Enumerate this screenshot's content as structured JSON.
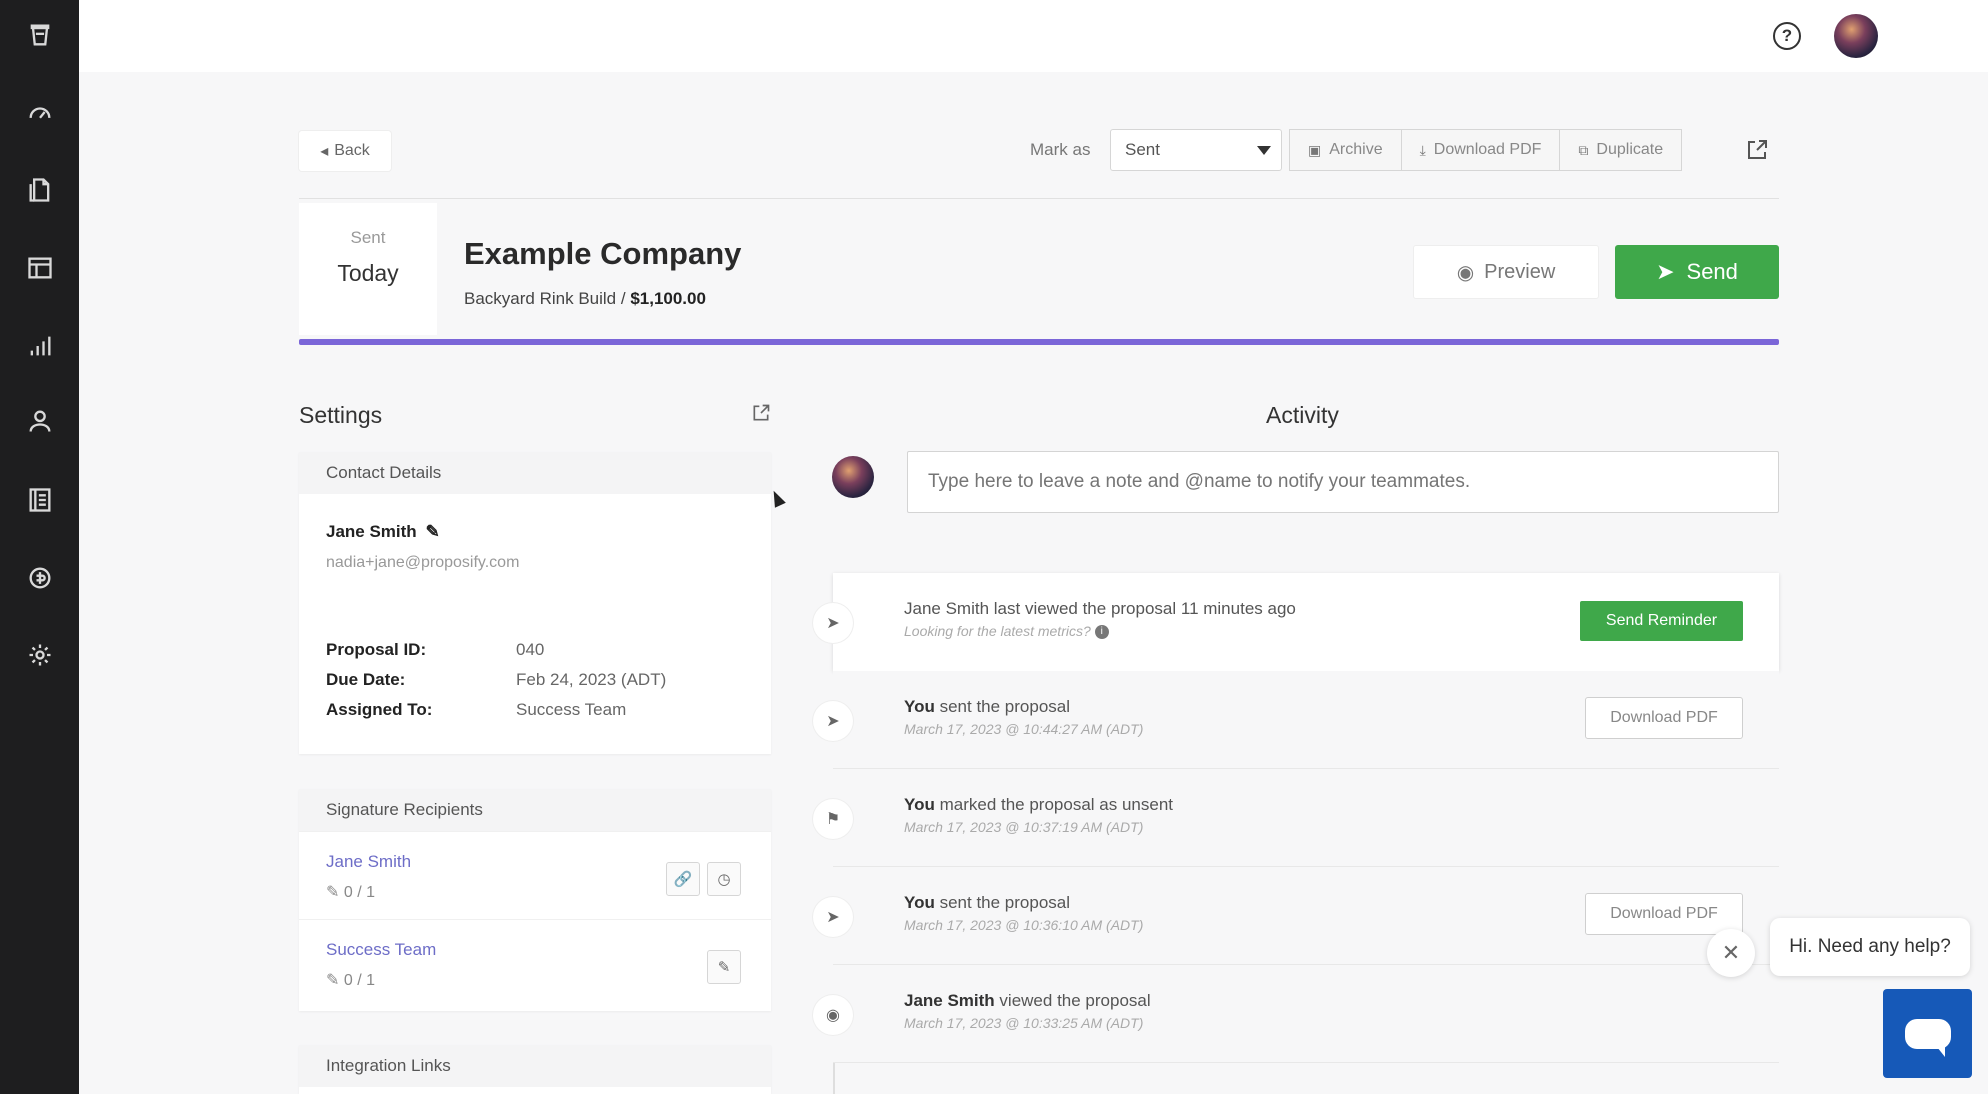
{
  "sidebar": {
    "icons": [
      "logo-cup-icon",
      "dashboard-gauge-icon",
      "documents-icon",
      "table-icon",
      "analytics-icon",
      "contacts-icon",
      "library-icon",
      "billing-icon",
      "settings-gear-icon"
    ]
  },
  "topbar": {
    "help_icon": "question-circle-icon"
  },
  "toolbar": {
    "back_label": "Back",
    "mark_as_label": "Mark as",
    "mark_as_value": "Sent",
    "archive_label": "Archive",
    "download_pdf_label": "Download PDF",
    "duplicate_label": "Duplicate"
  },
  "proposal": {
    "status_label": "Sent",
    "status_value": "Today",
    "company": "Example Company",
    "project": "Backyard Rink Build /",
    "amount": "$1,100.00",
    "preview_label": "Preview",
    "send_label": "Send"
  },
  "settings": {
    "title": "Settings",
    "contact": {
      "heading": "Contact Details",
      "name": "Jane Smith",
      "email": "nadia+jane@proposify.com",
      "fields": [
        {
          "key": "Proposal ID:",
          "value": "040"
        },
        {
          "key": "Due Date:",
          "value": "Feb 24, 2023 (ADT)"
        },
        {
          "key": "Assigned To:",
          "value": "Success Team"
        }
      ]
    },
    "signature": {
      "heading": "Signature Recipients",
      "recipients": [
        {
          "name": "Jane Smith",
          "count": "0 / 1"
        },
        {
          "name": "Success Team",
          "count": "0 / 1"
        }
      ]
    },
    "integration": {
      "heading": "Integration Links"
    }
  },
  "activity": {
    "title": "Activity",
    "note_placeholder": "Type here to leave a note and @name to notify your teammates.",
    "items": [
      {
        "actor": "Jane Smith",
        "text": " last viewed the proposal 11 minutes ago",
        "sub": "Looking for the latest metrics?",
        "action": "Send Reminder",
        "icon": "send-arrow-icon"
      },
      {
        "actor": "You",
        "text": " sent the proposal",
        "sub": "March 17, 2023 @ 10:44:27 AM (ADT)",
        "action": "Download PDF",
        "icon": "send-arrow-icon"
      },
      {
        "actor": "You",
        "text": " marked the proposal as unsent",
        "sub": "March 17, 2023 @ 10:37:19 AM (ADT)",
        "action": "",
        "icon": "flag-icon"
      },
      {
        "actor": "You",
        "text": " sent the proposal",
        "sub": "March 17, 2023 @ 10:36:10 AM (ADT)",
        "action": "Download PDF",
        "icon": "send-arrow-icon"
      },
      {
        "actor": "Jane Smith",
        "text": " viewed the proposal",
        "sub": "March 17, 2023 @ 10:33:25 AM (ADT)",
        "action": "",
        "icon": "eye-icon"
      }
    ]
  },
  "chat": {
    "greeting": "Hi. Need any help?"
  },
  "colors": {
    "sidebar": "#1e1e1f",
    "accent_green": "#3fa84a",
    "progress_purple": "#7b66d8",
    "link_purple": "#6d6dc7",
    "chat_blue": "#1659b8"
  }
}
